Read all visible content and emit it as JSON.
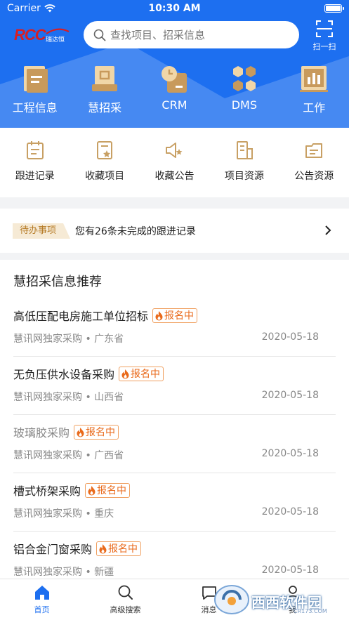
{
  "status_bar": {
    "carrier": "Carrier",
    "time": "10:30 AM"
  },
  "header": {
    "logo_text": "RCC",
    "logo_cn": "瑞达恒",
    "search_placeholder": "查找项目、招采信息",
    "scan_label": "扫一扫",
    "nav": [
      {
        "label": "工程信息",
        "icon": "document-icon"
      },
      {
        "label": "慧招采",
        "icon": "inbox-tray-icon"
      },
      {
        "label": "CRM",
        "icon": "clock-card-icon"
      },
      {
        "label": "DMS",
        "icon": "hexagon-cluster-icon"
      },
      {
        "label": "工作",
        "icon": "bar-chart-board-icon"
      }
    ]
  },
  "quick_menu": [
    {
      "label": "跟进记录",
      "icon": "calendar-icon"
    },
    {
      "label": "收藏项目",
      "icon": "starred-document-icon"
    },
    {
      "label": "收藏公告",
      "icon": "starred-megaphone-icon"
    },
    {
      "label": "项目资源",
      "icon": "building-icon"
    },
    {
      "label": "公告资源",
      "icon": "folder-icon"
    }
  ],
  "todo": {
    "tag": "待办事项",
    "text": "您有26条未完成的跟进记录"
  },
  "recommendations": {
    "title": "慧招采信息推荐",
    "items": [
      {
        "name": "高低压配电房施工单位招标",
        "badge": "报名中",
        "source": "慧讯网独家采购",
        "region": "广东省",
        "date": "2020-05-18",
        "visited": false
      },
      {
        "name": "无负压供水设备采购",
        "badge": "报名中",
        "source": "慧讯网独家采购",
        "region": "山西省",
        "date": "2020-05-18",
        "visited": false
      },
      {
        "name": "玻璃胶采购",
        "badge": "报名中",
        "source": "慧讯网独家采购",
        "region": "广西省",
        "date": "2020-05-18",
        "visited": true
      },
      {
        "name": "槽式桥架采购",
        "badge": "报名中",
        "source": "慧讯网独家采购",
        "region": "重庆",
        "date": "2020-05-18",
        "visited": false
      },
      {
        "name": "铝合金门窗采购",
        "badge": "报名中",
        "source": "慧讯网独家采购",
        "region": "新疆",
        "date": "2020-05-18",
        "visited": false
      }
    ]
  },
  "tab_bar": [
    {
      "label": "首页",
      "active": true
    },
    {
      "label": "高级搜索",
      "active": false
    },
    {
      "label": "消息",
      "active": false
    },
    {
      "label": "我",
      "active": false
    }
  ],
  "watermark": {
    "brand": "西西软件园",
    "url": "CR173.COM"
  },
  "colors": {
    "primary": "#1d6ff0",
    "accent_gold": "#c8a064",
    "badge_orange": "#e96a1b"
  }
}
